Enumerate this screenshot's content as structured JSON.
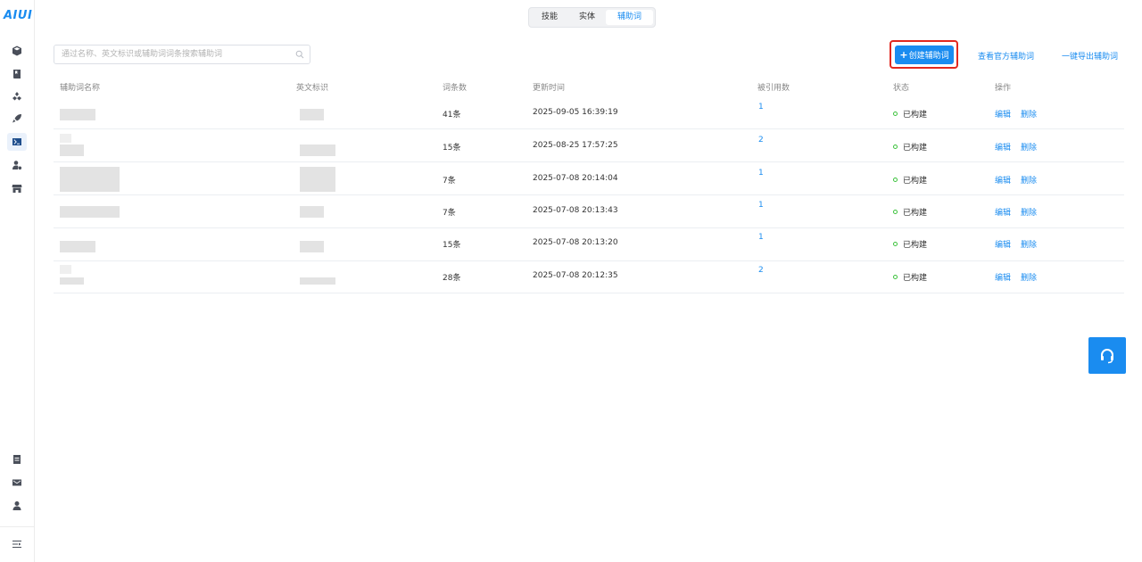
{
  "app": {
    "logo_text": "AIUI"
  },
  "tabs": [
    {
      "label": "技能",
      "active": false
    },
    {
      "label": "实体",
      "active": false
    },
    {
      "label": "辅助词",
      "active": true
    }
  ],
  "search": {
    "placeholder": "通过名称、英文标识或辅助词词条搜索辅助词"
  },
  "actions": {
    "create_label": "创建辅助词",
    "view_official_label": "查看官方辅助词",
    "export_label": "一键导出辅助词"
  },
  "table": {
    "headers": [
      "辅助词名称",
      "英文标识",
      "词条数",
      "更新时间",
      "被引用数",
      "状态",
      "操作"
    ],
    "rows": [
      {
        "count": "41条",
        "updated": "2025-09-05 16:39:19",
        "refs": "1",
        "status": "已构建",
        "edit": "编辑",
        "delete": "删除"
      },
      {
        "count": "15条",
        "updated": "2025-08-25 17:57:25",
        "refs": "2",
        "status": "已构建",
        "edit": "编辑",
        "delete": "删除"
      },
      {
        "count": "7条",
        "updated": "2025-07-08 20:14:04",
        "refs": "1",
        "status": "已构建",
        "edit": "编辑",
        "delete": "删除"
      },
      {
        "count": "7条",
        "updated": "2025-07-08 20:13:43",
        "refs": "1",
        "status": "已构建",
        "edit": "编辑",
        "delete": "删除"
      },
      {
        "count": "15条",
        "updated": "2025-07-08 20:13:20",
        "refs": "1",
        "status": "已构建",
        "edit": "编辑",
        "delete": "删除"
      },
      {
        "count": "28条",
        "updated": "2025-07-08 20:12:35",
        "refs": "2",
        "status": "已构建",
        "edit": "编辑",
        "delete": "删除"
      }
    ]
  },
  "sidebar": {
    "top_icons": [
      "cube-icon",
      "book-icon",
      "network-icon",
      "rocket-icon",
      "terminal-icon",
      "user-settings-icon",
      "store-icon"
    ],
    "active_icon": "terminal-icon",
    "bottom_icons": [
      "document-icon",
      "mail-icon",
      "user-icon",
      "menu-fold-icon"
    ]
  },
  "colors": {
    "accent": "#1a8cf0",
    "highlight_border": "#e2281f",
    "status_ok": "#3cc23c"
  }
}
